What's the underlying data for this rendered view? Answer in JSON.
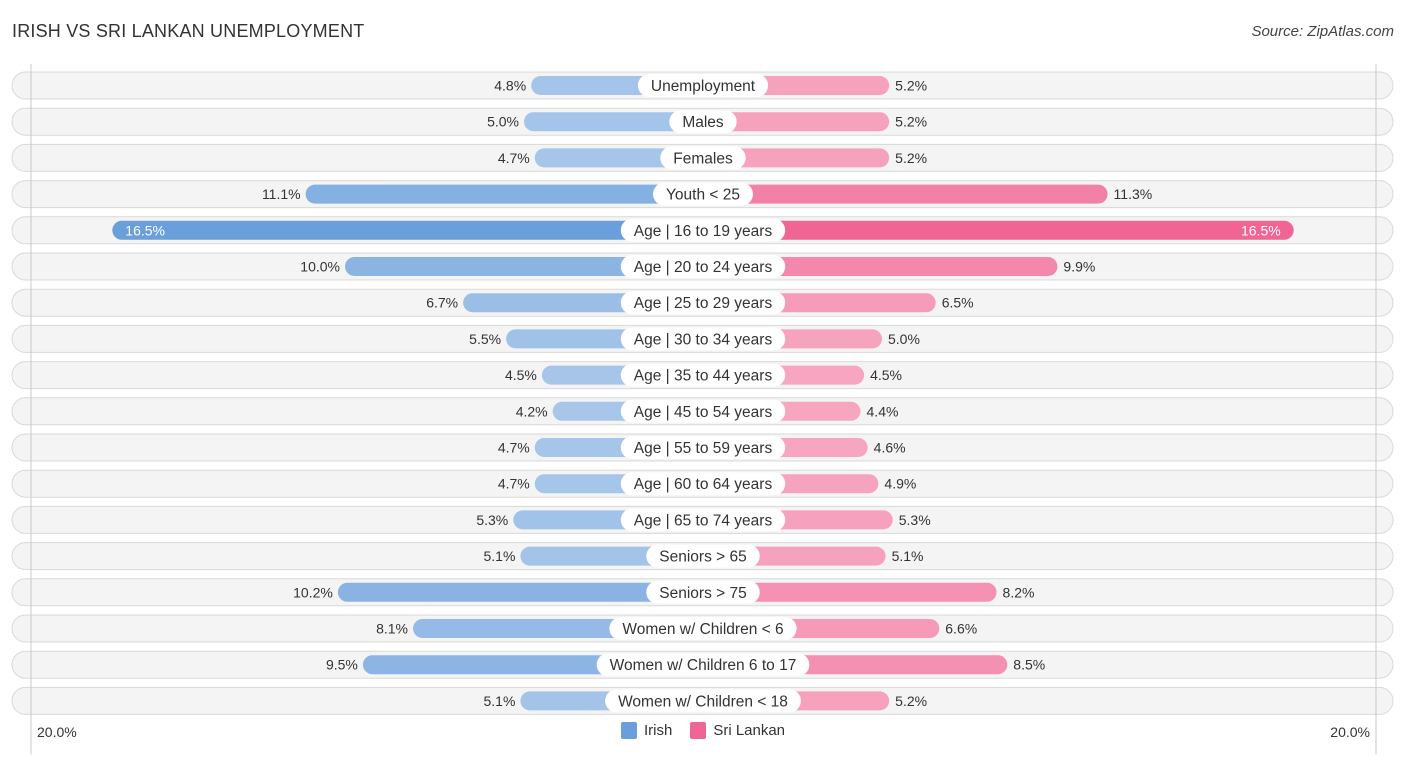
{
  "header": {
    "title": "IRISH VS SRI LANKAN UNEMPLOYMENT",
    "source": "Source: ZipAtlas.com"
  },
  "colors": {
    "irish": "#6a9fdc",
    "irish_light": "#a9c7ea",
    "sri_lankan": "#f06593",
    "sri_lankan_light": "#f7a8c2"
  },
  "chart_data": {
    "type": "bar",
    "orientation": "horizontal-diverging",
    "title": "IRISH VS SRI LANKAN UNEMPLOYMENT",
    "xlabel": "",
    "ylabel": "",
    "xlim": [
      -20,
      20
    ],
    "axis_labels": {
      "left": "20.0%",
      "right": "20.0%"
    },
    "legend": {
      "placement": "bottom-center",
      "entries": [
        "Irish",
        "Sri Lankan"
      ]
    },
    "categories": [
      "Unemployment",
      "Males",
      "Females",
      "Youth < 25",
      "Age | 16 to 19 years",
      "Age | 20 to 24 years",
      "Age | 25 to 29 years",
      "Age | 30 to 34 years",
      "Age | 35 to 44 years",
      "Age | 45 to 54 years",
      "Age | 55 to 59 years",
      "Age | 60 to 64 years",
      "Age | 65 to 74 years",
      "Seniors > 65",
      "Seniors > 75",
      "Women w/ Children < 6",
      "Women w/ Children 6 to 17",
      "Women w/ Children < 18"
    ],
    "series": [
      {
        "name": "Irish",
        "side": "left",
        "values": [
          4.8,
          5.0,
          4.7,
          11.1,
          16.5,
          10.0,
          6.7,
          5.5,
          4.5,
          4.2,
          4.7,
          4.7,
          5.3,
          5.1,
          10.2,
          8.1,
          9.5,
          5.1
        ],
        "labels": [
          "4.8%",
          "5.0%",
          "4.7%",
          "11.1%",
          "16.5%",
          "10.0%",
          "6.7%",
          "5.5%",
          "4.5%",
          "4.2%",
          "4.7%",
          "4.7%",
          "5.3%",
          "5.1%",
          "10.2%",
          "8.1%",
          "9.5%",
          "5.1%"
        ]
      },
      {
        "name": "Sri Lankan",
        "side": "right",
        "values": [
          5.2,
          5.2,
          5.2,
          11.3,
          16.5,
          9.9,
          6.5,
          5.0,
          4.5,
          4.4,
          4.6,
          4.9,
          5.3,
          5.1,
          8.2,
          6.6,
          8.5,
          5.2
        ],
        "labels": [
          "5.2%",
          "5.2%",
          "5.2%",
          "11.3%",
          "16.5%",
          "9.9%",
          "6.5%",
          "5.0%",
          "4.5%",
          "4.4%",
          "4.6%",
          "4.9%",
          "5.3%",
          "5.1%",
          "8.2%",
          "6.6%",
          "8.5%",
          "5.2%"
        ]
      }
    ]
  }
}
